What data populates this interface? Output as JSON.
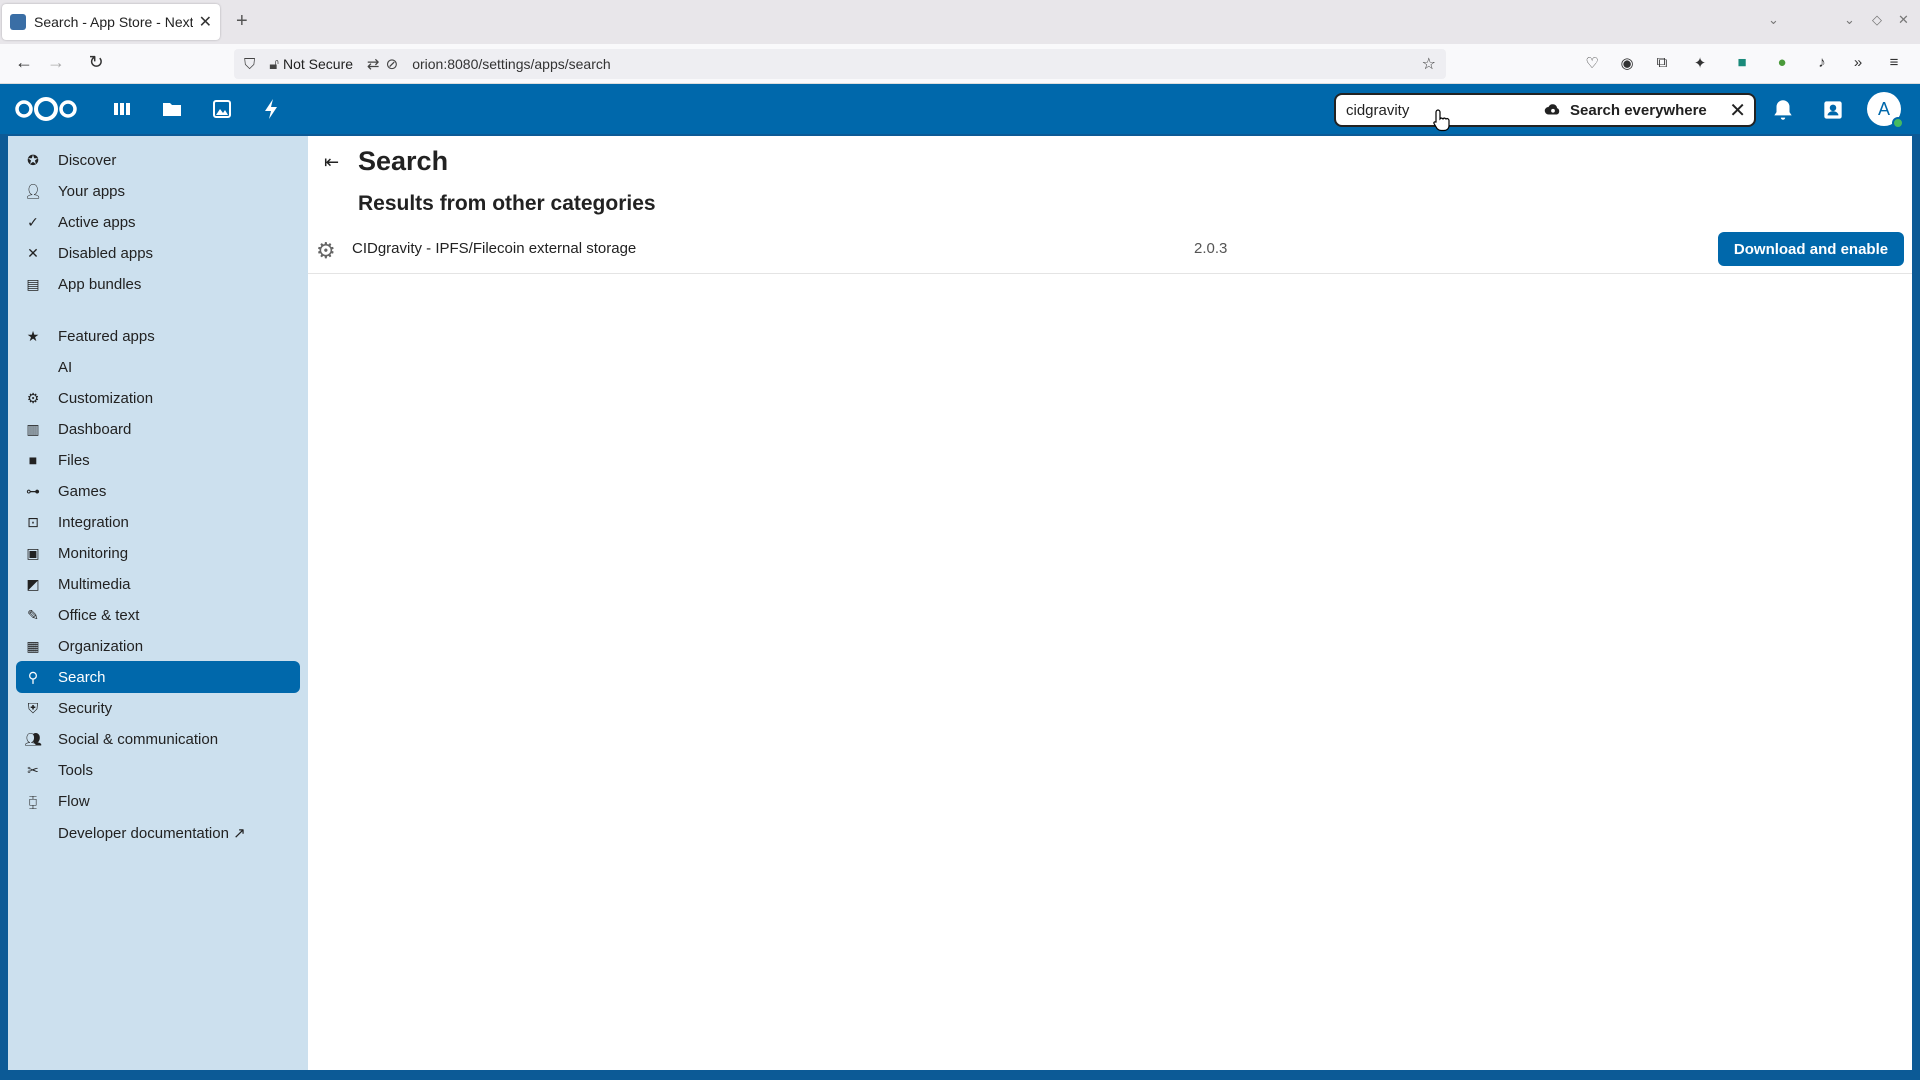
{
  "browser": {
    "tab_title": "Search - App Store - Nextcl",
    "tab_close": "✕",
    "new_tab": "+",
    "security_label": "Not Secure",
    "url": "orion:8080/settings/apps/search"
  },
  "header": {
    "search_value": "cidgravity",
    "search_everywhere_label": "Search everywhere",
    "avatar_letter": "A"
  },
  "sidebar": {
    "items": [
      {
        "label": "Discover",
        "icon": "compass-icon"
      },
      {
        "label": "Your apps",
        "icon": "user-icon"
      },
      {
        "label": "Active apps",
        "icon": "check-icon"
      },
      {
        "label": "Disabled apps",
        "icon": "close-icon"
      },
      {
        "label": "App bundles",
        "icon": "archive-icon"
      },
      {
        "label": "Featured apps",
        "icon": "star-icon"
      },
      {
        "label": "AI",
        "icon": ""
      },
      {
        "label": "Customization",
        "icon": "gear-icon"
      },
      {
        "label": "Dashboard",
        "icon": "dashboard-icon"
      },
      {
        "label": "Files",
        "icon": "folder-icon"
      },
      {
        "label": "Games",
        "icon": "gamepad-icon"
      },
      {
        "label": "Integration",
        "icon": "integration-icon"
      },
      {
        "label": "Monitoring",
        "icon": "monitor-icon"
      },
      {
        "label": "Multimedia",
        "icon": "multimedia-icon"
      },
      {
        "label": "Office & text",
        "icon": "document-icon"
      },
      {
        "label": "Organization",
        "icon": "organization-icon"
      },
      {
        "label": "Search",
        "icon": "search-icon"
      },
      {
        "label": "Security",
        "icon": "shield-icon"
      },
      {
        "label": "Social & communication",
        "icon": "people-icon"
      },
      {
        "label": "Tools",
        "icon": "tools-icon"
      },
      {
        "label": "Flow",
        "icon": "flow-icon"
      },
      {
        "label": "Developer documentation ↗",
        "icon": ""
      }
    ],
    "active": "Search"
  },
  "main": {
    "title": "Search",
    "subtitle": "Results from other categories",
    "results": [
      {
        "name": "CIDgravity - IPFS/Filecoin external storage",
        "version": "2.0.3",
        "action": "Download and enable"
      }
    ]
  },
  "colors": {
    "header_bg": "#0068ab",
    "sidebar_bg": "#cce0ee",
    "accent": "#0068ab"
  }
}
